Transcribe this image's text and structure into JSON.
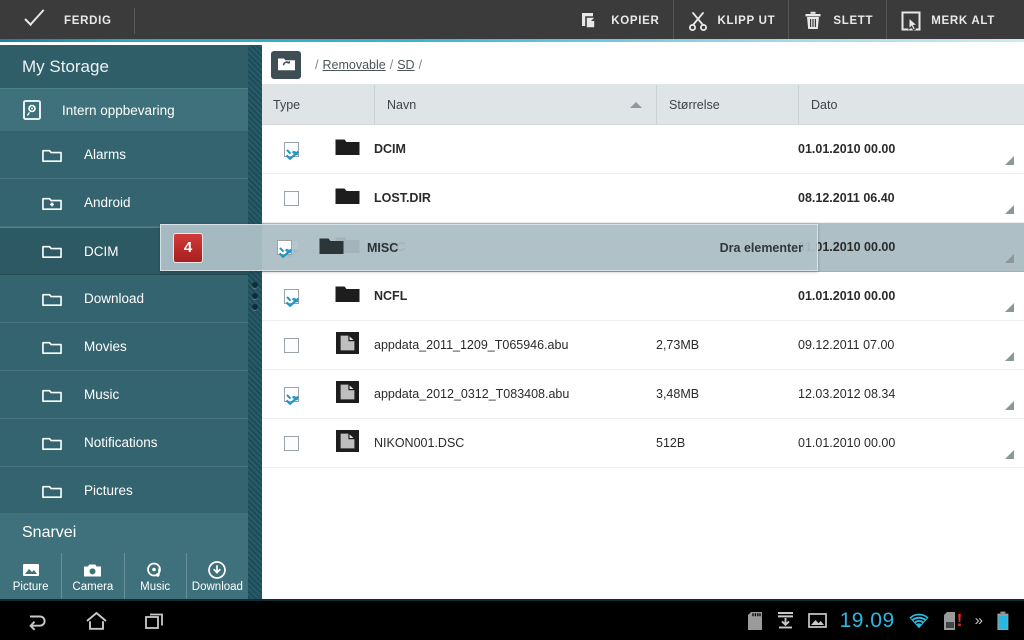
{
  "topbar": {
    "done_label": "FERDIG",
    "done_icon": "check-icon",
    "actions": [
      {
        "label": "KOPIER",
        "icon": "copy-icon"
      },
      {
        "label": "KLIPP UT",
        "icon": "scissors-icon"
      },
      {
        "label": "SLETT",
        "icon": "trash-icon"
      },
      {
        "label": "MERK ALT",
        "icon": "select-all-icon"
      }
    ]
  },
  "sidebar": {
    "title": "My Storage",
    "root": {
      "label": "Intern oppbevaring",
      "icon": "hard-drive-icon"
    },
    "items": [
      {
        "label": "Alarms",
        "icon": "folder-icon"
      },
      {
        "label": "Android",
        "icon": "folder-plus-icon"
      },
      {
        "label": "DCIM",
        "icon": "folder-icon"
      },
      {
        "label": "Download",
        "icon": "folder-icon"
      },
      {
        "label": "Movies",
        "icon": "folder-icon"
      },
      {
        "label": "Music",
        "icon": "folder-icon"
      },
      {
        "label": "Notifications",
        "icon": "folder-icon"
      },
      {
        "label": "Pictures",
        "icon": "folder-icon"
      }
    ],
    "selected_index": 2,
    "shortcuts_title": "Snarvei",
    "shortcuts": [
      {
        "label": "Picture",
        "icon": "picture-icon"
      },
      {
        "label": "Camera",
        "icon": "camera-icon"
      },
      {
        "label": "Music",
        "icon": "music-icon"
      },
      {
        "label": "Download",
        "icon": "download-icon"
      }
    ]
  },
  "breadcrumb": {
    "icon": "folder-refresh-icon",
    "lead": "/",
    "parts": [
      "Removable",
      "SD"
    ],
    "trail": "/"
  },
  "table": {
    "columns": [
      {
        "key": "type",
        "label": "Type"
      },
      {
        "key": "name",
        "label": "Navn",
        "sorted": "asc"
      },
      {
        "key": "size",
        "label": "Størrelse"
      },
      {
        "key": "date",
        "label": "Dato"
      }
    ],
    "rows": [
      {
        "checked": true,
        "icon": "folder-icon",
        "name": "DCIM",
        "size": "",
        "date": "01.01.2010 00.00",
        "is_dir": true,
        "highlight": false
      },
      {
        "checked": false,
        "icon": "folder-icon",
        "name": "LOST.DIR",
        "size": "",
        "date": "08.12.2011 06.40",
        "is_dir": true,
        "highlight": false
      },
      {
        "checked": true,
        "icon": "folder-icon",
        "name": "MISC",
        "size": "",
        "date": "01.01.2010 00.00",
        "is_dir": true,
        "highlight": true
      },
      {
        "checked": true,
        "icon": "folder-icon",
        "name": "NCFL",
        "size": "",
        "date": "01.01.2010 00.00",
        "is_dir": true,
        "highlight": false
      },
      {
        "checked": false,
        "icon": "file-icon",
        "name": "appdata_2011_1209_T065946.abu",
        "size": "2,73MB",
        "date": "09.12.2011 07.00",
        "is_dir": false,
        "highlight": false
      },
      {
        "checked": true,
        "icon": "file-icon",
        "name": "appdata_2012_0312_T083408.abu",
        "size": "3,48MB",
        "date": "12.03.2012 08.34",
        "is_dir": false,
        "highlight": false
      },
      {
        "checked": false,
        "icon": "file-icon",
        "name": "NIKON001.DSC",
        "size": "512B",
        "date": "01.01.2010 00.00",
        "is_dir": false,
        "highlight": false
      }
    ]
  },
  "drag": {
    "count": "4",
    "label": "Dra elementer",
    "item_name": "MISC",
    "item_icon": "folder-icon",
    "checked": true
  },
  "navbar": {
    "back_icon": "back-icon",
    "home_icon": "home-icon",
    "recents_icon": "recents-icon",
    "status_icons": [
      "sd-card-icon",
      "download-icon",
      "image-icon"
    ],
    "clock": "19.09",
    "right_icons": [
      "wifi-icon",
      "sim-alert-icon",
      "more-chevron-icon",
      "battery-icon"
    ]
  },
  "colors": {
    "accent": "#29b8e0",
    "sidebar": "#33646f",
    "topbar": "#3b3b3b",
    "badge_red": "#b92222",
    "row_highlight": "#aebfc6"
  }
}
